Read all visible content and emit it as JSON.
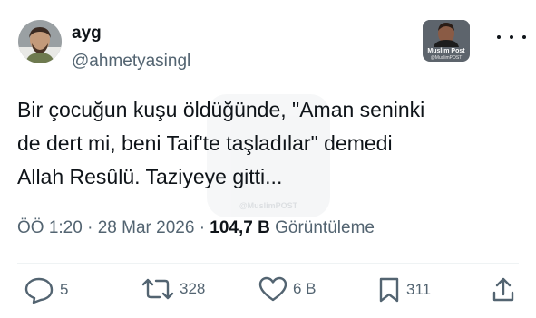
{
  "author": {
    "display_name": "ayg",
    "handle": "@ahmetyasingl",
    "avatar_icon": "avatar-photo"
  },
  "badge": {
    "title": "Muslim Post",
    "subtitle": "@MuslimPOST"
  },
  "watermark": {
    "text": "@MuslimPOST"
  },
  "tweet": {
    "lines": [
      "Bir çocuğun kuşu öldüğünde, \"Aman seninki",
      "de dert mi, beni Taif'te taşladılar\" demedi",
      "Allah Resûlü. Taziyeye gitti..."
    ]
  },
  "meta": {
    "time": "ÖÖ 1:20",
    "separator": "·",
    "date": "28 Mar 2026",
    "views_count": "104,7 B",
    "views_label": "Görüntüleme"
  },
  "actions": {
    "replies": "5",
    "reposts": "328",
    "likes": "6 B",
    "bookmarks": "311"
  },
  "colors": {
    "text_primary": "#0f1419",
    "text_secondary": "#536471",
    "divider": "#eff3f4"
  }
}
